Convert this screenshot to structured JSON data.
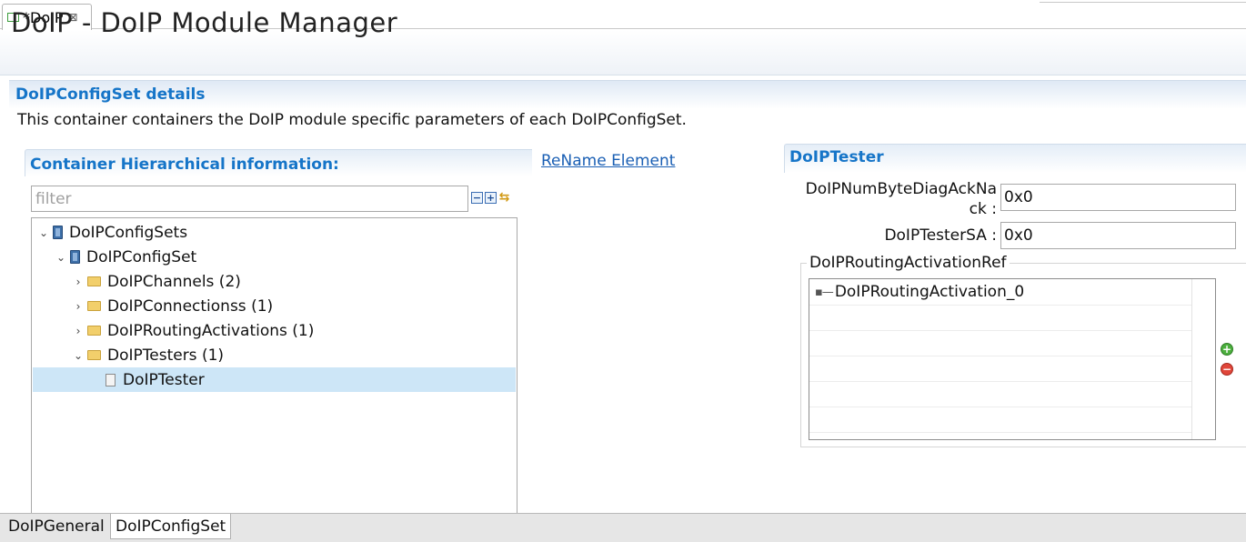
{
  "editor_tab": {
    "label": "*DoIP",
    "close": "⊠"
  },
  "form": {
    "title": "DoIP - DoIP Module Manager"
  },
  "section": {
    "title": "DoIPConfigSet details",
    "description": "This container containers the DoIP module specific parameters of each DoIPConfigSet."
  },
  "hierarchy": {
    "title": "Container Hierarchical information:",
    "rename_link": "ReName Element",
    "filter_placeholder": "filter",
    "tree": [
      {
        "label": "DoIPConfigSets",
        "twisty": "⌄",
        "icon": "book-icon"
      },
      {
        "label": "DoIPConfigSet",
        "twisty": "⌄",
        "icon": "book-icon"
      },
      {
        "label": "DoIPChannels (2)",
        "twisty": "›",
        "icon": "folder-icon"
      },
      {
        "label": "DoIPConnectionss (1)",
        "twisty": "›",
        "icon": "folder-icon"
      },
      {
        "label": "DoIPRoutingActivations (1)",
        "twisty": "›",
        "icon": "folder-icon"
      },
      {
        "label": "DoIPTesters (1)",
        "twisty": "⌄",
        "icon": "folder-icon"
      },
      {
        "label": "DoIPTester",
        "twisty": "",
        "icon": "page-icon",
        "selected": true
      }
    ]
  },
  "tester": {
    "title": "DoIPTester",
    "num_byte_label_1": "DoIPNumByteDiagAckNa",
    "num_byte_label_2": "ck :",
    "num_byte_value": "0x0",
    "tester_sa_label": "DoIPTesterSA :",
    "tester_sa_value": "0x0",
    "routing_ref_legend": "DoIPRoutingActivationRef",
    "routing_ref_items": [
      "DoIPRoutingActivation_0"
    ],
    "add_symbol": "+",
    "remove_symbol": "−"
  },
  "bottom_tabs": [
    "DoIPGeneral",
    "DoIPConfigSet"
  ],
  "colors": {
    "accent": "#1675c8",
    "selection": "#cde6f7"
  }
}
